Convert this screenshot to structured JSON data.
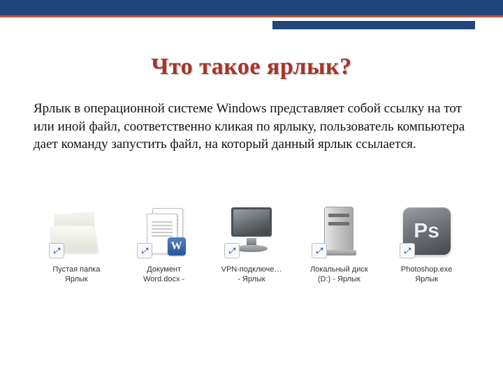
{
  "title": "Что такое ярлык?",
  "body": "Ярлык в операционной системе Windows представляет собой ссылку на тот или иной файл, соответственно кликая по ярлыку, пользователь компьютера дает команду запустить файл, на который данный ярлык ссылается.",
  "shortcuts": [
    {
      "label": "Пустая папка\nЯрлык"
    },
    {
      "label": "Документ\nWord.docx -"
    },
    {
      "label": "VPN-подключе…\n- Ярлык"
    },
    {
      "label": "Локальный диск\n(D:) - Ярлык"
    },
    {
      "label": "Photoshop.exe\nЯрлык"
    }
  ]
}
